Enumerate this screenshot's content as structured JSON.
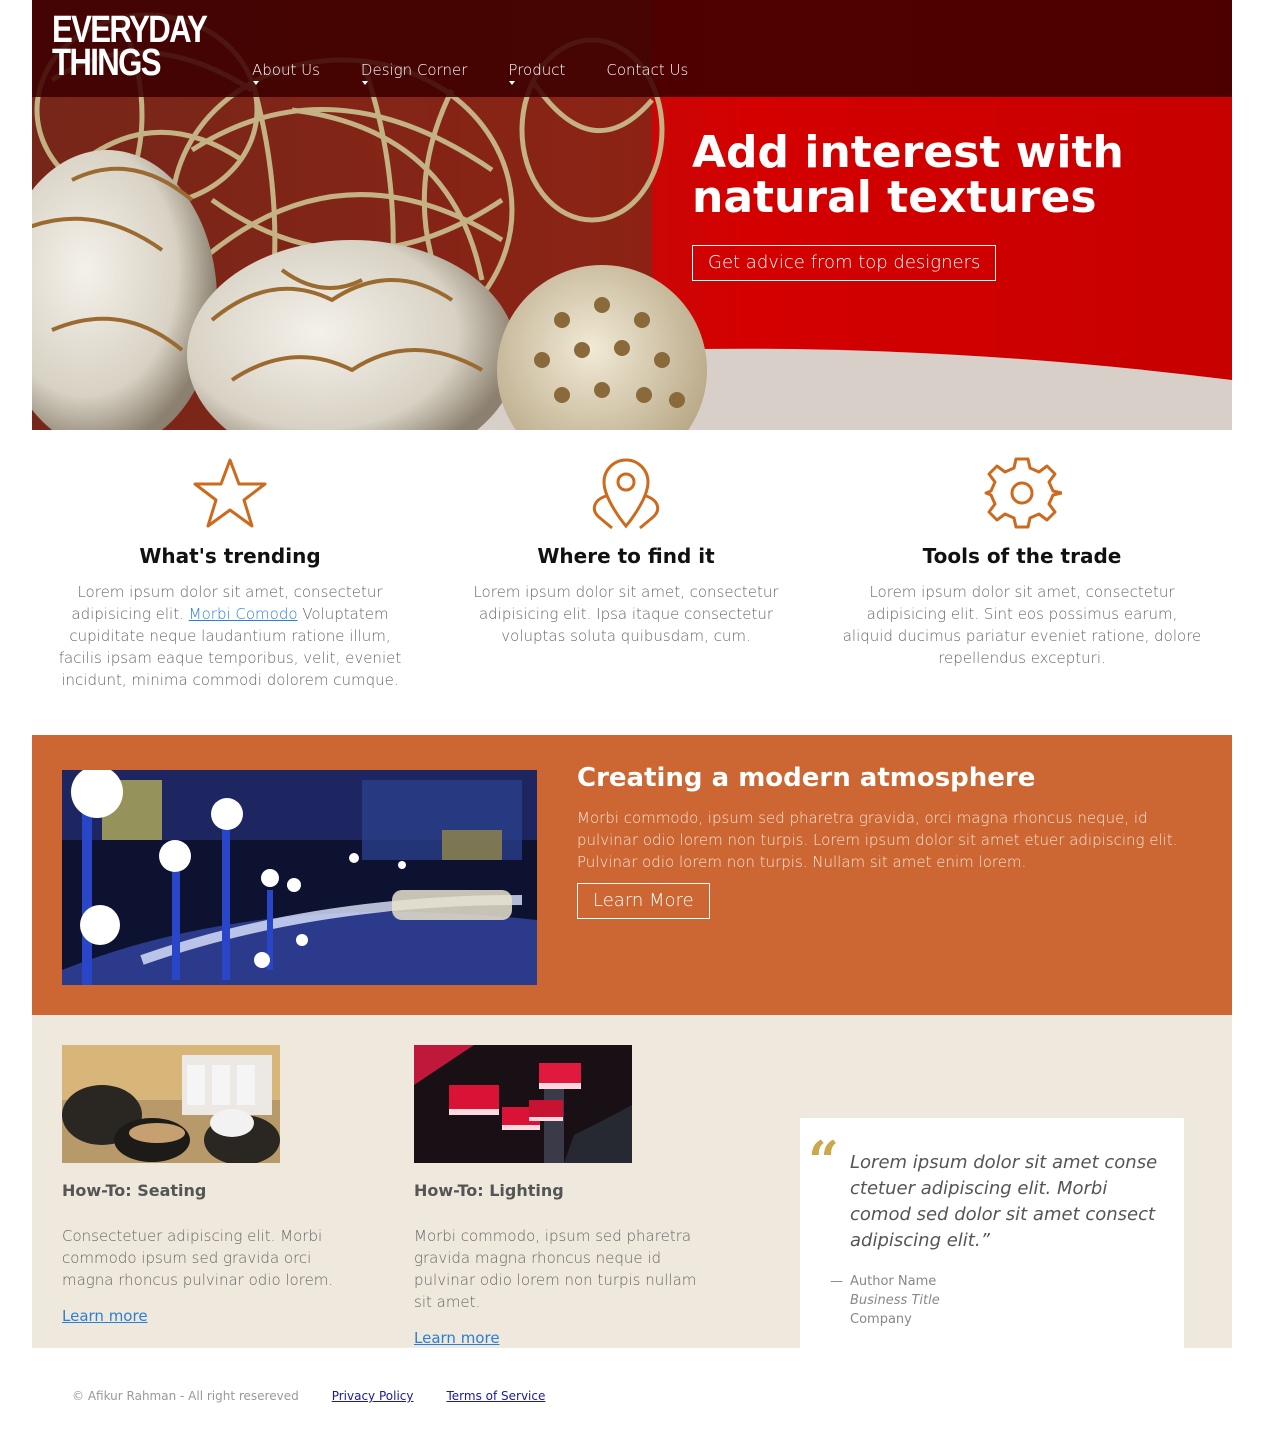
{
  "brand": {
    "line1": "EVERYDAY",
    "line2": "THINGS"
  },
  "nav": {
    "items": [
      {
        "label": "About Us",
        "has_dropdown": true
      },
      {
        "label": "Design Corner",
        "has_dropdown": true
      },
      {
        "label": "Product",
        "has_dropdown": true
      },
      {
        "label": "Contact Us",
        "has_dropdown": false
      }
    ]
  },
  "hero": {
    "title": "Add interest with natural textures",
    "button_label": "Get advice from top designers"
  },
  "features": [
    {
      "icon": "star-icon",
      "title": "What's trending",
      "text_before": "Lorem ipsum dolor sit amet, consectetur adipisicing elit.",
      "link": "Morbi Comodo",
      "text_after": "Voluptatem cupiditate neque laudantium ratione illum, facilis ipsam eaque temporibus, velit, eveniet incidunt, minima commodi dolorem cumque."
    },
    {
      "icon": "location-pin-icon",
      "title": "Where to find it",
      "text": "Lorem ipsum dolor sit amet, consectetur adipisicing elit. Ipsa itaque consectetur voluptas soluta quibusdam, cum."
    },
    {
      "icon": "gear-icon",
      "title": "Tools of the trade",
      "text": "Lorem ipsum dolor sit amet, consectetur adipisicing elit. Sint eos possimus earum, aliquid ducimus pariatur eveniet ratione, dolore repellendus excepturi."
    }
  ],
  "band": {
    "title": "Creating a modern atmosphere",
    "text": "Morbi commodo, ipsum sed pharetra gravida, orci magna rhoncus neque, id pulvinar odio lorem non turpis. Lorem ipsum dolor sit amet etuer adipiscing elit. Pulvinar odio lorem non turpis. Nullam sit amet enim lorem.",
    "button_label": "Learn More"
  },
  "cards": [
    {
      "title": "How-To: Seating",
      "text": "Consectetuer adipiscing elit. Morbi commodo ipsum sed gravida orci magna rhoncus pulvinar odio lorem.",
      "link": "Learn more"
    },
    {
      "title": "How-To: Lighting",
      "text": "Morbi commodo, ipsum sed pharetra gravida magna rhoncus neque id pulvinar odio lorem non turpis nullam sit amet.",
      "link": "Learn more"
    }
  ],
  "quote": {
    "mark": "“",
    "text": "Lorem ipsum dolor sit amet conse ctetuer adipiscing elit. Morbi comod sed dolor sit amet consect adipiscing elit.”",
    "dash": "—",
    "author": "Author Name",
    "business_title": "Business Title",
    "company": "Company"
  },
  "footer": {
    "copyright": "© Afikur Rahman - All right resereved",
    "privacy": "Privacy Policy",
    "terms": "Terms of Service"
  },
  "colors": {
    "topbar": "#3c0000",
    "hero_red": "#d40000",
    "accent_orange": "#cc6633",
    "icon_orange": "#cc6a1e",
    "beige": "#efe8dc",
    "quote_gold": "#c9a94c",
    "link_blue": "#2a7fd4"
  }
}
